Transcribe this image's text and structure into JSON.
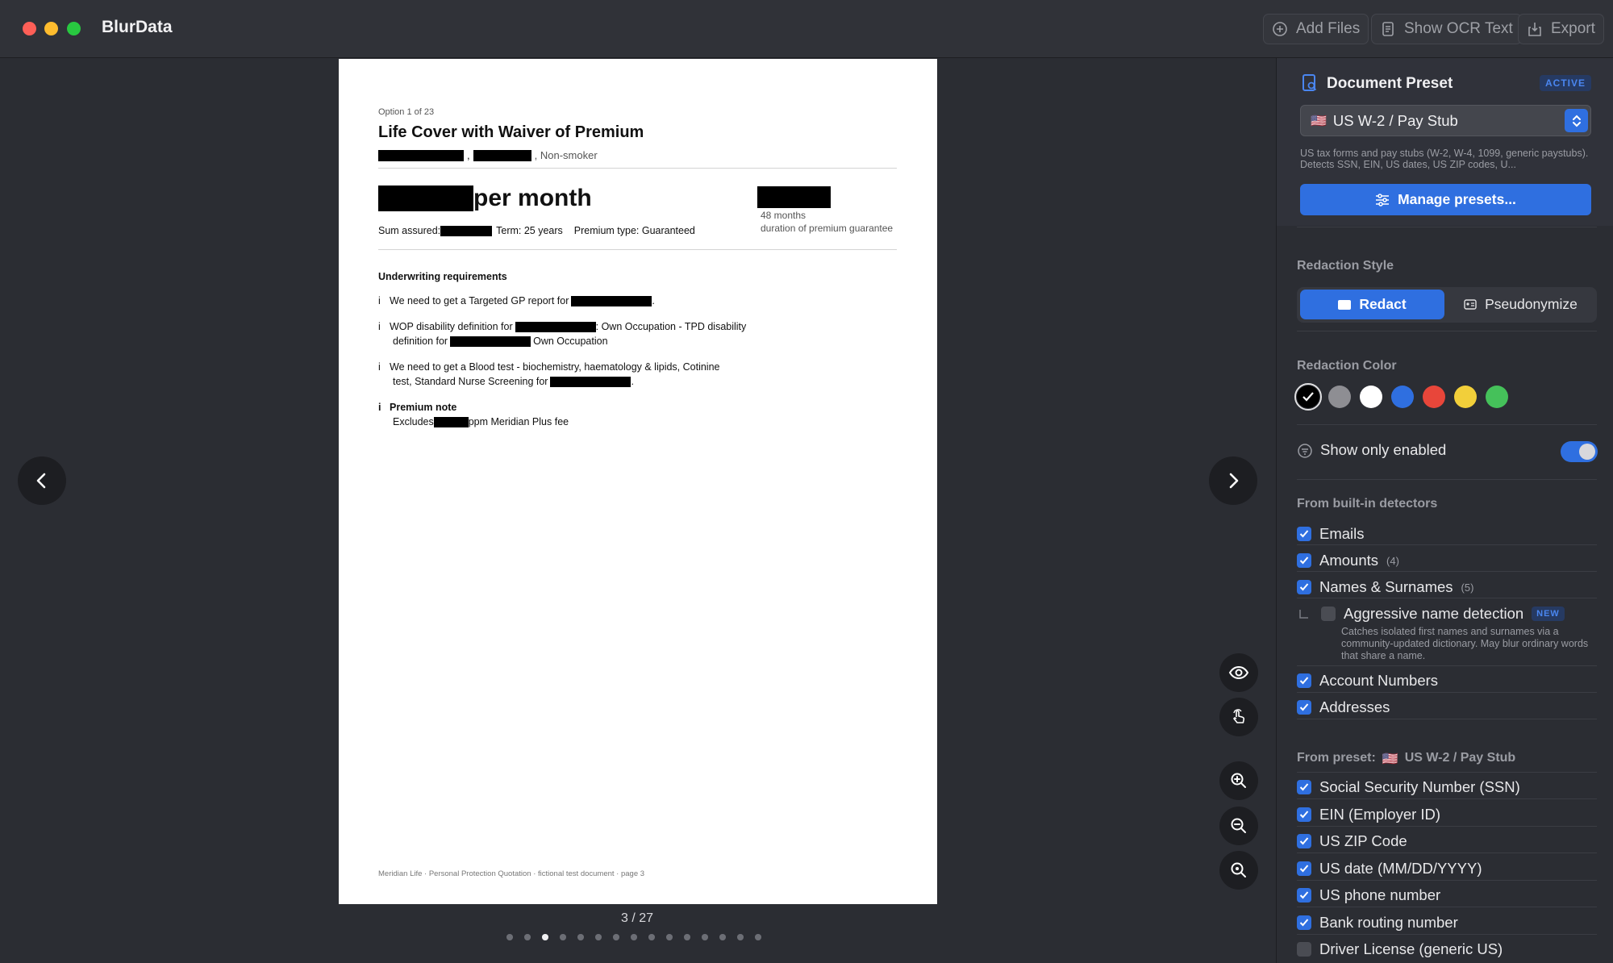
{
  "app": {
    "title": "BlurData"
  },
  "toolbar": {
    "add_files": "Add Files",
    "show_ocr": "Show OCR Text",
    "export": "Export"
  },
  "document": {
    "option_label": "Option 1 of 23",
    "title": "Life Cover with Waiver of Premium",
    "subtitle_tail": ", Non-smoker",
    "price_suffix": "per month",
    "months": "48 months",
    "guarantee": "duration of premium guarantee",
    "sum_assured": "Sum assured:",
    "term": "Term: 25 years",
    "premium_type": "Premium type: Guaranteed",
    "uw_heading": "Underwriting requirements",
    "bullet": "i",
    "req1": "We need to get a Targeted GP report for",
    "req2a": "WOP disability definition for",
    "req2b": ": Own Occupation - TPD disability",
    "req2c": "definition for",
    "req2d": "Own Occupation",
    "req3a": "We need to get a Blood test - biochemistry, haematology & lipids, Cotinine",
    "req3b": "test, Standard Nurse Screening for",
    "premium_note": "Premium note",
    "excludes_a": "Excludes",
    "excludes_b": "ppm Meridian Plus fee",
    "footer": "Meridian Life · Personal Protection Quotation · fictional test document · page 3"
  },
  "viewer": {
    "page_indicator": "3 / 27",
    "total_dots": 15,
    "active_dot": 2
  },
  "sidebar": {
    "preset_title": "Document Preset",
    "active_badge": "ACTIVE",
    "preset_selected": "US W-2 / Pay Stub",
    "preset_flag": "🇺🇸",
    "preset_desc": "US tax forms and pay stubs (W-2, W-4, 1099, generic paystubs). Detects SSN, EIN, US dates, US ZIP codes, U...",
    "manage_btn": "Manage presets...",
    "redaction_style_title": "Redaction Style",
    "style_redact": "Redact",
    "style_pseudo": "Pseudonymize",
    "redaction_color_title": "Redaction Color",
    "colors": [
      "#000000",
      "#8e8e93",
      "#ffffff",
      "#2f6fe0",
      "#e8463a",
      "#f2cf3a",
      "#45c15a"
    ],
    "show_only_enabled": "Show only enabled",
    "builtin_title": "From built-in detectors",
    "builtin": [
      {
        "label": "Emails",
        "checked": true,
        "count": ""
      },
      {
        "label": "Amounts",
        "checked": true,
        "count": "(4)"
      },
      {
        "label": "Names & Surnames",
        "checked": true,
        "count": "(5)"
      }
    ],
    "aggressive_label": "Aggressive name detection",
    "aggressive_badge": "NEW",
    "aggressive_desc": "Catches isolated first names and surnames via a community-updated dictionary. May blur ordinary words that share a name.",
    "builtin2": [
      {
        "label": "Account Numbers",
        "checked": true
      },
      {
        "label": "Addresses",
        "checked": true
      }
    ],
    "preset_section_prefix": "From preset:",
    "preset_section_name": "US W-2 / Pay Stub",
    "preset_items": [
      {
        "label": "Social Security Number (SSN)",
        "checked": true
      },
      {
        "label": "EIN (Employer ID)",
        "checked": true
      },
      {
        "label": "US ZIP Code",
        "checked": true
      },
      {
        "label": "US date (MM/DD/YYYY)",
        "checked": true
      },
      {
        "label": "US phone number",
        "checked": true
      },
      {
        "label": "Bank routing number",
        "checked": true
      },
      {
        "label": "Driver License (generic US)",
        "checked": false
      }
    ]
  }
}
